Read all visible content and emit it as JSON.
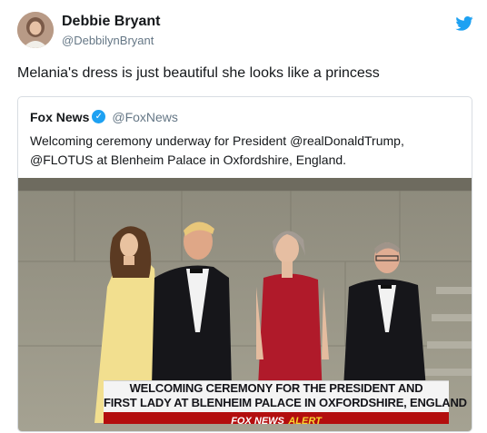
{
  "author": {
    "name": "Debbie Bryant",
    "handle": "@DebbilynBryant"
  },
  "tweet": {
    "text": "Melania's dress is just beautiful she looks like a princess"
  },
  "quoted": {
    "name": "Fox News",
    "handle": "@FoxNews",
    "verified_icon": "verified-badge-icon",
    "text_lines": [
      "Welcoming ceremony underway for President @realDonaldTrump,",
      "@FLOTUS at Blenheim Palace in Oxfordshire, England."
    ]
  },
  "media": {
    "chyron_lines": [
      "WELCOMING CEREMONY FOR THE PRESIDENT AND",
      "FIRST LADY AT BLENHEIM PALACE IN OXFORDSHIRE, ENGLAND"
    ],
    "alert_brand": "FOX NEWS",
    "alert_word": "ALERT"
  },
  "colors": {
    "twitter_blue": "#1da1f2",
    "alert_red": "#b30e0e",
    "alert_yellow": "#f7d52f"
  }
}
